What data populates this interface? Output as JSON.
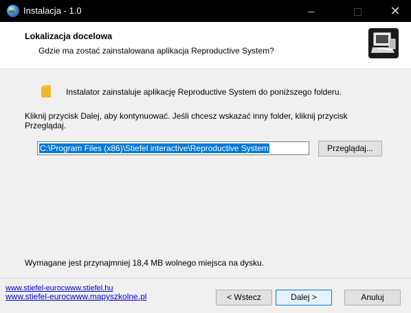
{
  "window": {
    "title": "Instalacja - 1.0",
    "controls": {
      "minimize": "—",
      "maximize": "□",
      "close": "✕"
    }
  },
  "header": {
    "title": "Lokalizacja docelowa",
    "subtitle": "Gdzie ma zostać zainstalowana aplikacja Reproductive System?"
  },
  "content": {
    "info": "Instalator zainstaluje aplikację Reproductive System do poniższego folderu.",
    "instruction": "Kliknij przycisk Dalej, aby kontynuować. Jeśli chcesz wskazać inny folder, kliknij przycisk Przeglądaj.",
    "path_value": "C:\\Program Files (x86)\\Stiefel interactive\\Reproductive System",
    "browse_label": "Przeglądaj...",
    "space_required": "Wymagane jest przynajmniej 18,4 MB wolnego miejsca na dysku."
  },
  "footer": {
    "link1": "www.stiefel-eurocwww.stiefel.hu",
    "link2": "www.stiefel-eurocwww.mapyszkolne.pl",
    "back_label": "< Wstecz",
    "next_label": "Dalej >",
    "cancel_label": "Anuluj"
  },
  "colors": {
    "titlebar": "#000000",
    "selection": "#0078d7",
    "link": "#0000cc"
  }
}
